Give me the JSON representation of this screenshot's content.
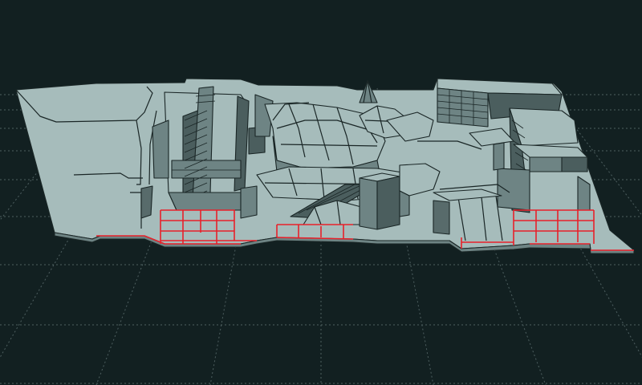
{
  "viewport": {
    "kind": "3d-model-viewport",
    "background_color": "#122021",
    "grid_color": "#4e5f60",
    "model_top_color": "#a6bcbb",
    "model_side_color": "#6e8484",
    "section_cut_color": "#e8202a"
  }
}
